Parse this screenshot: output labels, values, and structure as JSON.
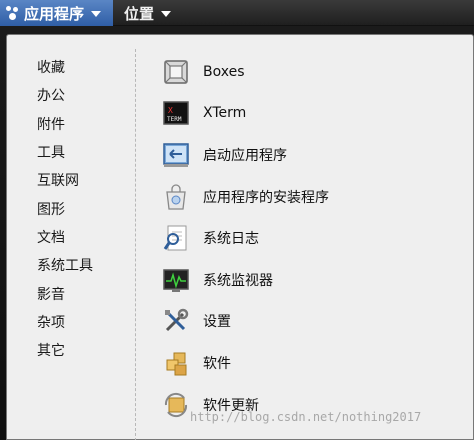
{
  "topbar": {
    "applications_label": "应用程序",
    "places_label": "位置"
  },
  "categories": [
    "收藏",
    "办公",
    "附件",
    "工具",
    "互联网",
    "图形",
    "文档",
    "系统工具",
    "影音",
    "杂项",
    "其它"
  ],
  "apps": [
    {
      "label": "Boxes",
      "icon": "boxes-icon"
    },
    {
      "label": "XTerm",
      "icon": "xterm-icon"
    },
    {
      "label": "启动应用程序",
      "icon": "startup-applications-icon"
    },
    {
      "label": "应用程序的安装程序",
      "icon": "software-installer-icon"
    },
    {
      "label": "系统日志",
      "icon": "system-log-icon"
    },
    {
      "label": "系统监视器",
      "icon": "system-monitor-icon"
    },
    {
      "label": "设置",
      "icon": "settings-icon"
    },
    {
      "label": "软件",
      "icon": "software-icon"
    },
    {
      "label": "软件更新",
      "icon": "software-update-icon"
    }
  ],
  "watermark": "http://blog.csdn.net/nothing2017",
  "colors": {
    "accent": "#3f6fb5",
    "panel_bg": "#efefef",
    "topbar_bg": "#2a2a2a"
  }
}
